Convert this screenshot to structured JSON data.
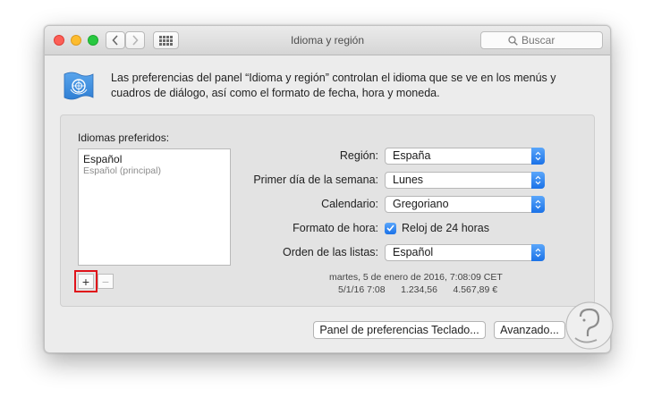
{
  "window": {
    "title": "Idioma y región",
    "search_placeholder": "Buscar"
  },
  "description": "Las preferencias del panel “Idioma y región” controlan el idioma que se ve en los menús y cuadros de diálogo, así como el formato de fecha, hora y moneda.",
  "languages": {
    "label": "Idiomas preferidos:",
    "items": [
      {
        "name": "Español",
        "subtitle": "Español (principal)"
      }
    ],
    "add_label": "+",
    "remove_label": "−"
  },
  "settings": {
    "region_label": "Región:",
    "region_value": "España",
    "first_day_label": "Primer día de la semana:",
    "first_day_value": "Lunes",
    "calendar_label": "Calendario:",
    "calendar_value": "Gregoriano",
    "time_format_label": "Formato de hora:",
    "time_format_checkbox": "Reloj de 24 horas",
    "time_format_checked": true,
    "list_order_label": "Orden de las listas:",
    "list_order_value": "Español"
  },
  "format_preview": {
    "line1": "martes, 5 de enero de 2016, 7:08:09 CET",
    "date_short": "5/1/16 7:08",
    "number": "1.234,56",
    "currency": "4.567,89 €"
  },
  "buttons": {
    "keyboard_prefs": "Panel de preferencias Teclado...",
    "advanced": "Avanzado..."
  },
  "colors": {
    "accent": "#1b72e8",
    "highlight_box": "#e0121a",
    "flag": "#3d8ede"
  }
}
